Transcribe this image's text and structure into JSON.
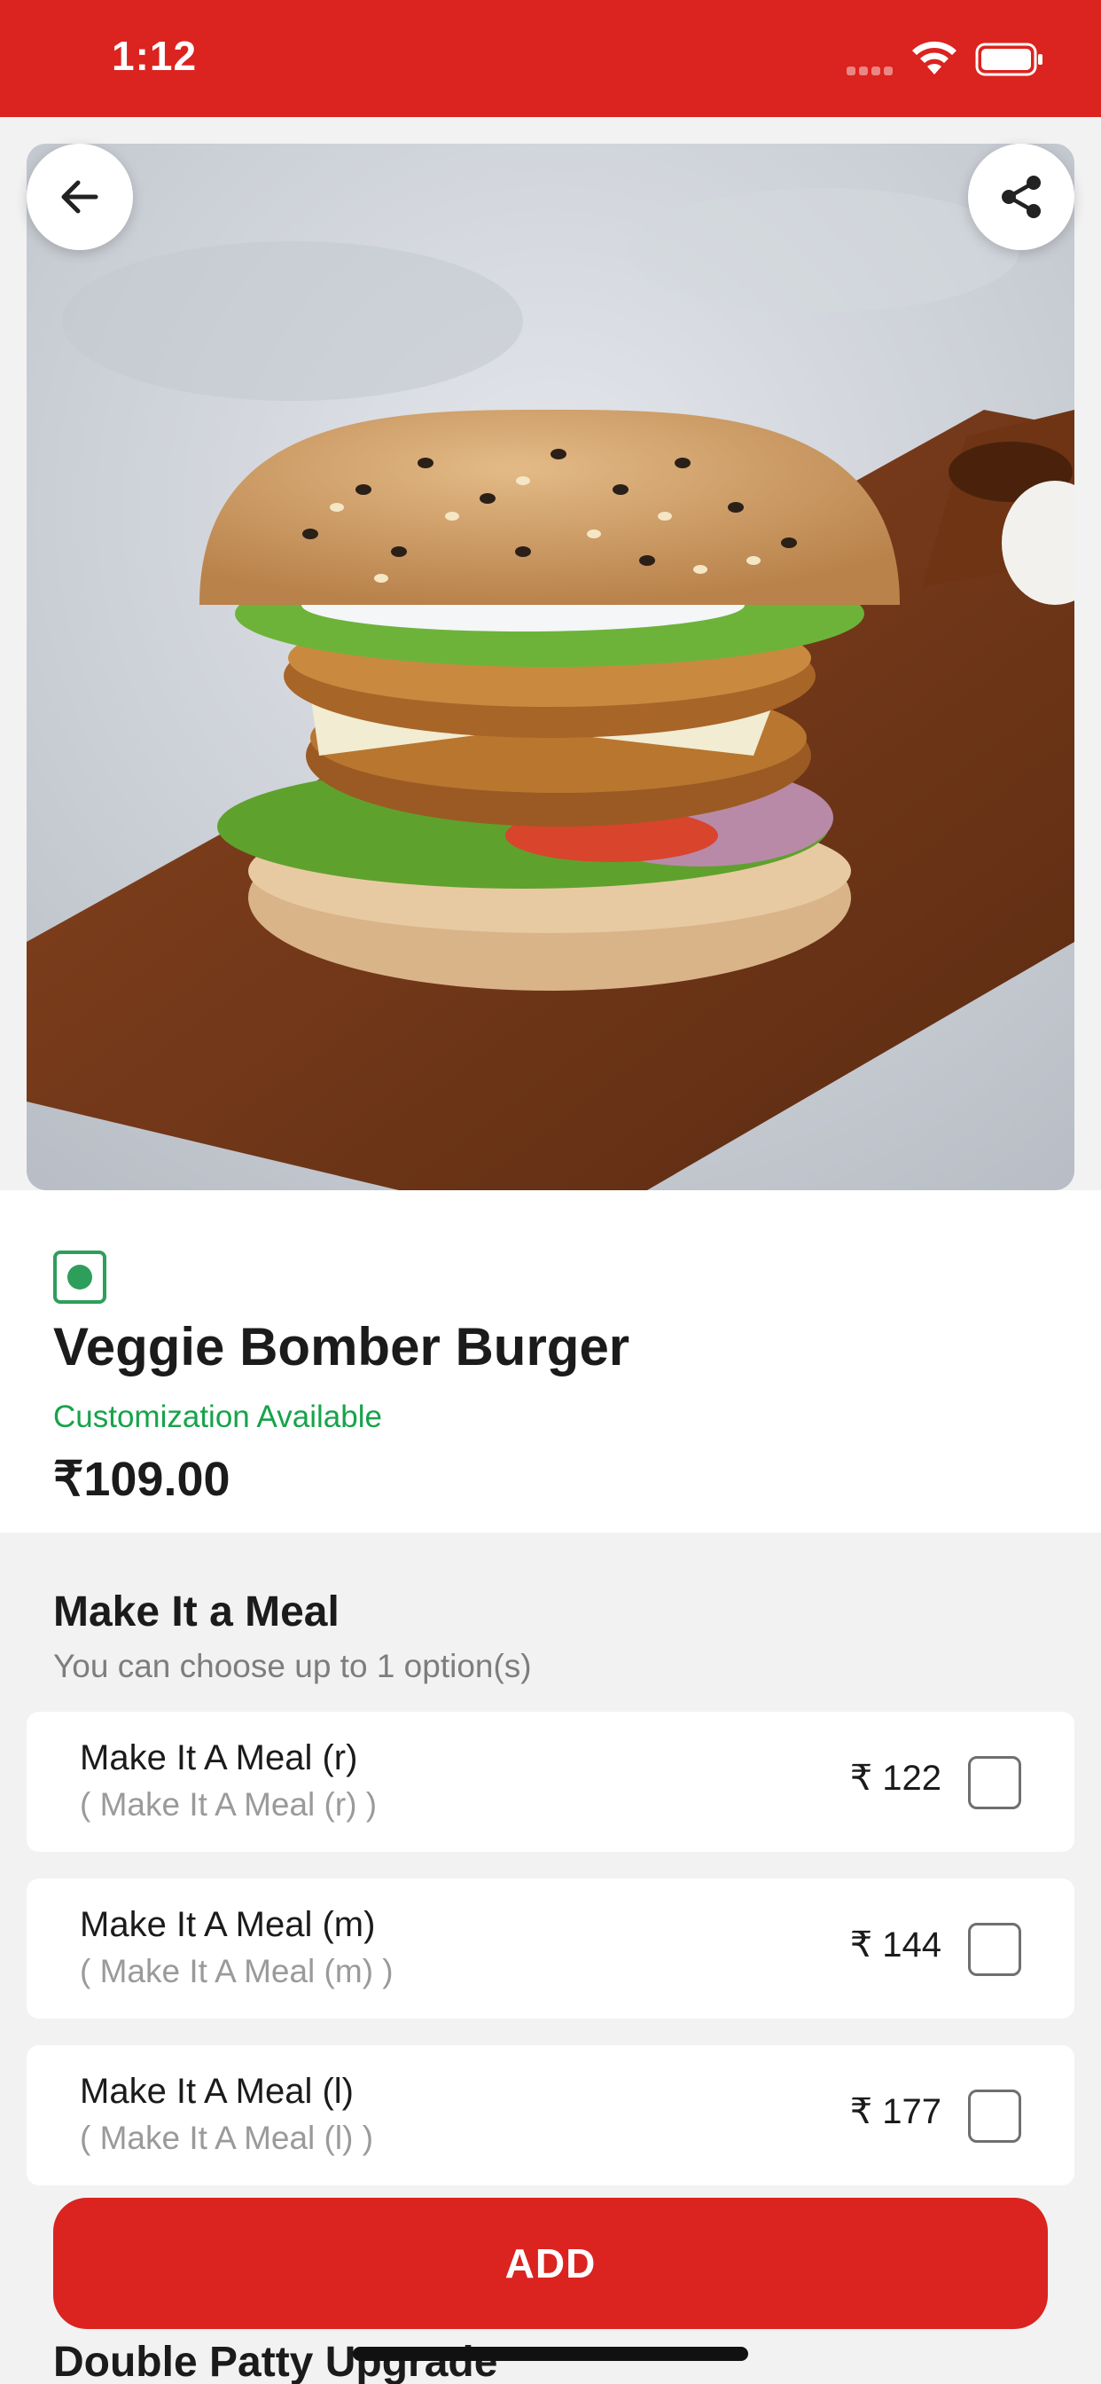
{
  "status_bar": {
    "time": "1:12",
    "icons": [
      "signal-icon",
      "wifi-icon",
      "battery-icon"
    ],
    "background": "#db231f"
  },
  "header": {
    "back_icon": "arrow-left-icon",
    "share_icon": "share-icon"
  },
  "product": {
    "image": "veggie-bomber-burger-photo",
    "veg_indicator_color": "#2e9e5b",
    "name": "Veggie Bomber Burger",
    "customization": "Customization Available",
    "price": "₹109.00"
  },
  "meal_section": {
    "title": "Make It a Meal",
    "subtitle": "You can choose up to 1 option(s)",
    "options": [
      {
        "name": "Make It A Meal (r)",
        "description": "( Make It A Meal (r) )",
        "price": "₹ 122",
        "checked": false
      },
      {
        "name": "Make It A Meal (m)",
        "description": "( Make It A Meal (m) )",
        "price": "₹ 144",
        "checked": false
      },
      {
        "name": "Make It A Meal (l)",
        "description": "( Make It A Meal (l) )",
        "price": "₹ 177",
        "checked": false
      }
    ]
  },
  "next_section": {
    "title": "Double Patty Upgrade"
  },
  "actions": {
    "add_label": "ADD",
    "accent": "#db231f"
  }
}
